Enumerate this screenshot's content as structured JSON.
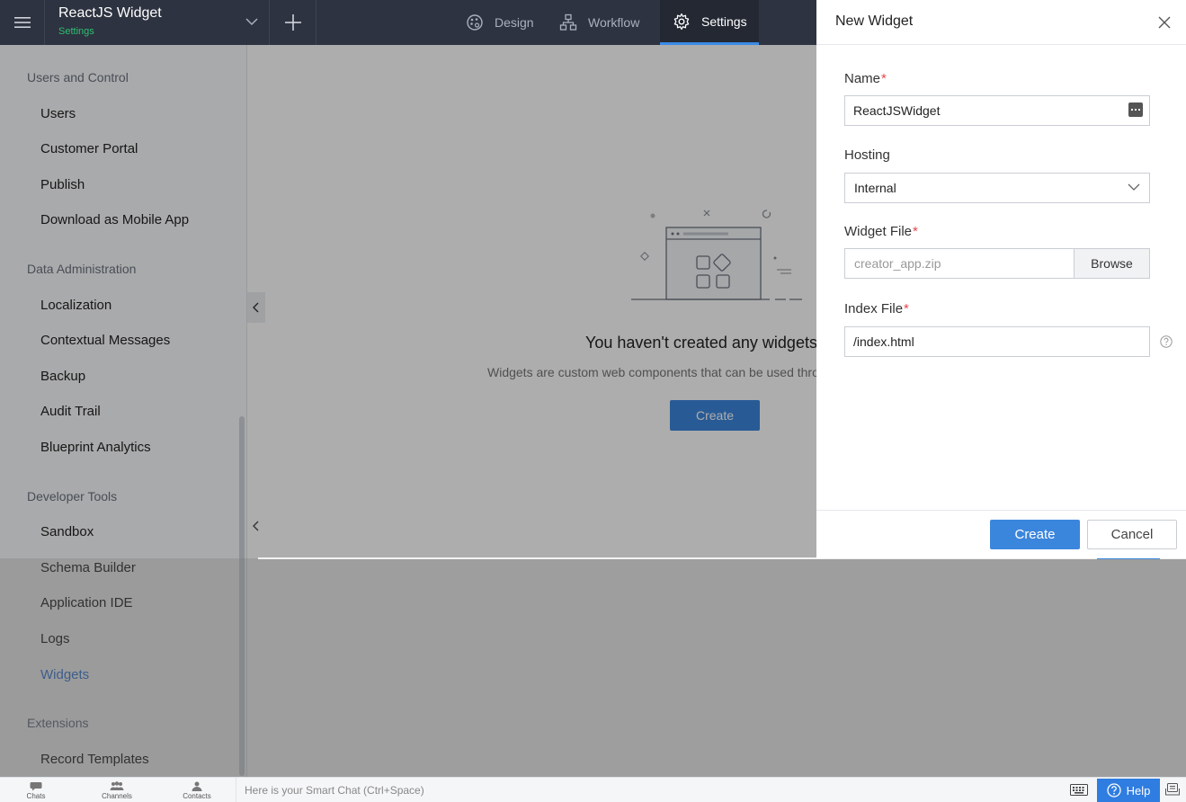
{
  "app": {
    "title": "ReactJS Widget",
    "subtitle": "Settings"
  },
  "nav": {
    "tabs": [
      {
        "label": "Design",
        "icon": "palette-icon",
        "active": false
      },
      {
        "label": "Workflow",
        "icon": "workflow-icon",
        "active": false
      },
      {
        "label": "Settings",
        "icon": "gear-icon",
        "active": true
      }
    ]
  },
  "sidebar": {
    "sections": [
      {
        "title": "Users and Control",
        "items": [
          "Users",
          "Customer Portal",
          "Publish",
          "Download as Mobile App"
        ]
      },
      {
        "title": "Data Administration",
        "items": [
          "Localization",
          "Contextual Messages",
          "Backup",
          "Audit Trail",
          "Blueprint Analytics"
        ]
      },
      {
        "title": "Developer Tools",
        "items": [
          "Sandbox",
          "Schema Builder",
          "Application IDE",
          "Logs",
          "Widgets"
        ]
      },
      {
        "title": "Extensions",
        "items": [
          "Record Templates"
        ]
      }
    ],
    "active_item": "Widgets"
  },
  "main": {
    "empty_title": "You haven't created any widgets",
    "empty_description": "Widgets are custom web components that can be used thro",
    "create_label": "Create"
  },
  "drawer": {
    "title": "New Widget",
    "fields": {
      "name": {
        "label": "Name",
        "value": "ReactJSWidget"
      },
      "hosting": {
        "label": "Hosting",
        "value": "Internal"
      },
      "widget_file": {
        "label": "Widget File",
        "placeholder": "creator_app.zip",
        "browse_label": "Browse"
      },
      "index_file": {
        "label": "Index File",
        "value": "/index.html"
      }
    },
    "required_mark": "*",
    "create_label": "Create",
    "cancel_label": "Cancel"
  },
  "bottombar": {
    "tabs": [
      "Chats",
      "Channels",
      "Contacts"
    ],
    "smart_chat_placeholder": "Here is your Smart Chat (Ctrl+Space)",
    "help_label": "Help"
  },
  "colors": {
    "topbar": "#2d3340",
    "accent": "#3b86dd",
    "subtitle": "#2fbf71",
    "required": "#e5484d"
  }
}
